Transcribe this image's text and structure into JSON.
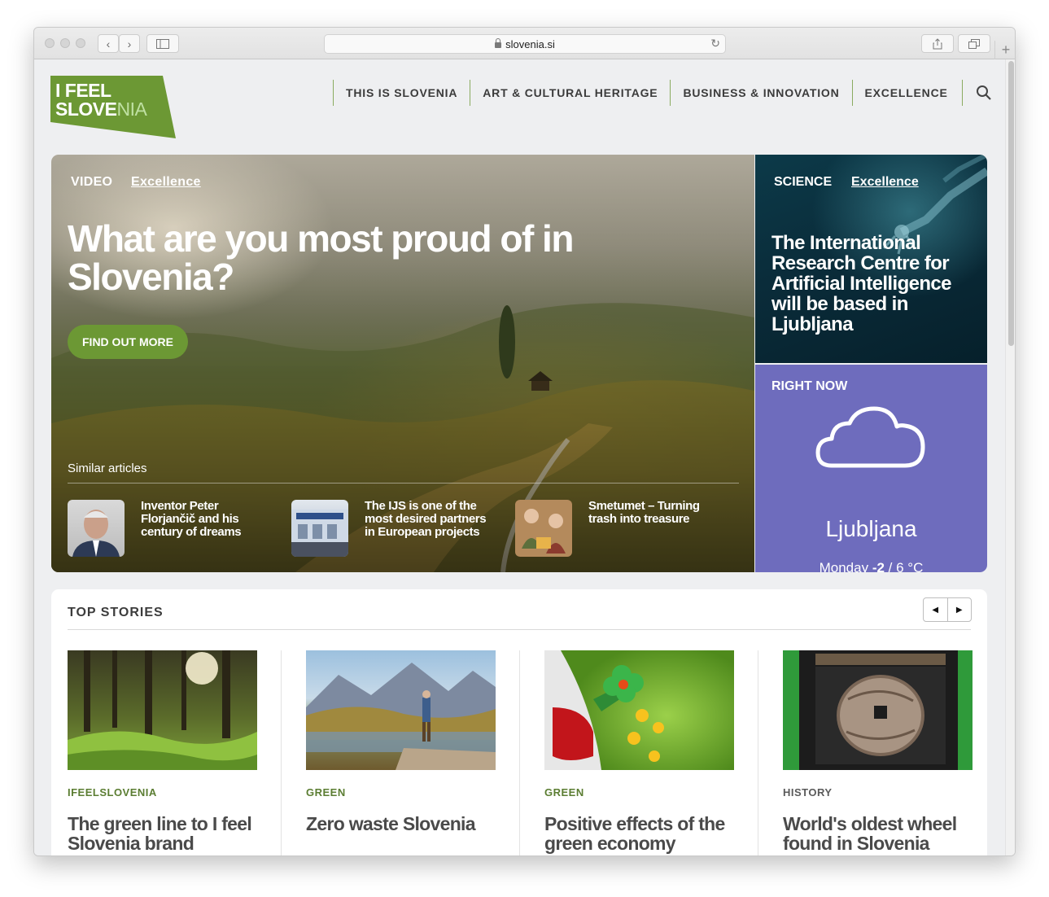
{
  "browser": {
    "url": "slovenia.si"
  },
  "logo": {
    "line1": "I FEEL",
    "line2_a": "SLOVE",
    "line2_b": "NIA"
  },
  "nav": {
    "items": [
      "THIS IS SLOVENIA",
      "ART & CULTURAL HERITAGE",
      "BUSINESS & INNOVATION",
      "EXCELLENCE"
    ]
  },
  "hero": {
    "tag": "VIDEO",
    "category": "Excellence",
    "title": "What are you most proud of in Slovenia?",
    "button": "FIND OUT MORE",
    "similar_label": "Similar articles",
    "similar": [
      {
        "title": "Inventor Peter Florjančič and his century of dreams"
      },
      {
        "title": "The IJS is one of the most desired partners in European projects"
      },
      {
        "title": "Smetumet – Turning trash into treasure"
      }
    ]
  },
  "science": {
    "tag": "SCIENCE",
    "category": "Excellence",
    "title": "The International Research Centre for Artificial Intelligence will be based in Ljubljana"
  },
  "weather": {
    "label": "RIGHT NOW",
    "city": "Ljubljana",
    "day": "Monday",
    "low": "-2",
    "high": "6 °C"
  },
  "top_stories": {
    "title": "TOP STORIES",
    "cards": [
      {
        "category": "IFEELSLOVENIA",
        "title": "The green line to I feel Slovenia brand"
      },
      {
        "category": "GREEN",
        "title": "Zero waste Slovenia"
      },
      {
        "category": "GREEN",
        "title": "Positive effects of the green economy"
      },
      {
        "category": "HISTORY",
        "title": "World's oldest wheel found in Slovenia"
      }
    ]
  },
  "colors": {
    "brand_green": "#6c9834",
    "weather_purple": "#6e6cbd",
    "science_teal": "#0a2c3a"
  }
}
